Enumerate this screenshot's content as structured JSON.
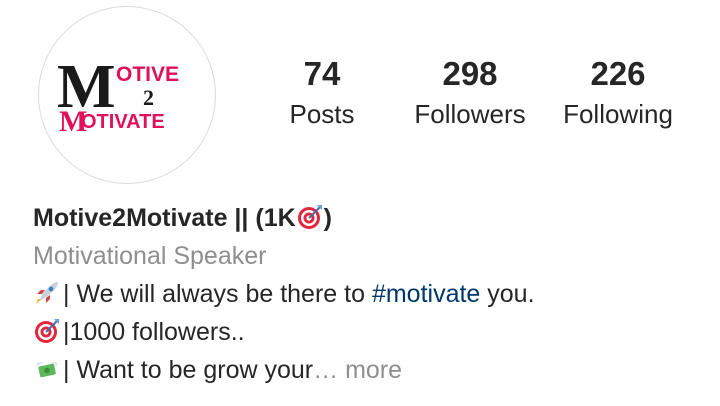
{
  "avatar": {
    "logo_big_m_top": "M",
    "logo_word_top": "OTIVE",
    "logo_number": "2",
    "logo_big_m_bottom": "M",
    "logo_word_bottom": "OTIVATE",
    "colors": {
      "dark": "#1a1a1a",
      "accent": "#e0105a"
    }
  },
  "stats": {
    "posts": {
      "count": "74",
      "label": "Posts"
    },
    "followers": {
      "count": "298",
      "label": "Followers"
    },
    "following": {
      "count": "226",
      "label": "Following"
    }
  },
  "bio": {
    "name_prefix": "Motive2Motivate || (1K",
    "name_suffix": ")",
    "name_emoji": "target-icon",
    "category": "Motivational Speaker",
    "line1_emoji": "rocket-icon",
    "line1_text": "| We will always be there to ",
    "line1_hashtag": "#motivate",
    "line1_end": " you.",
    "line2_emoji": "target-icon",
    "line2_text": "|1000 followers..",
    "line3_emoji": "money-with-wings-icon",
    "line3_text": "| Want to be grow your",
    "more_label": "… more",
    "colors": {
      "category": "#8e8e8e",
      "hashtag": "#00376b",
      "more": "#8e8e8e"
    }
  }
}
